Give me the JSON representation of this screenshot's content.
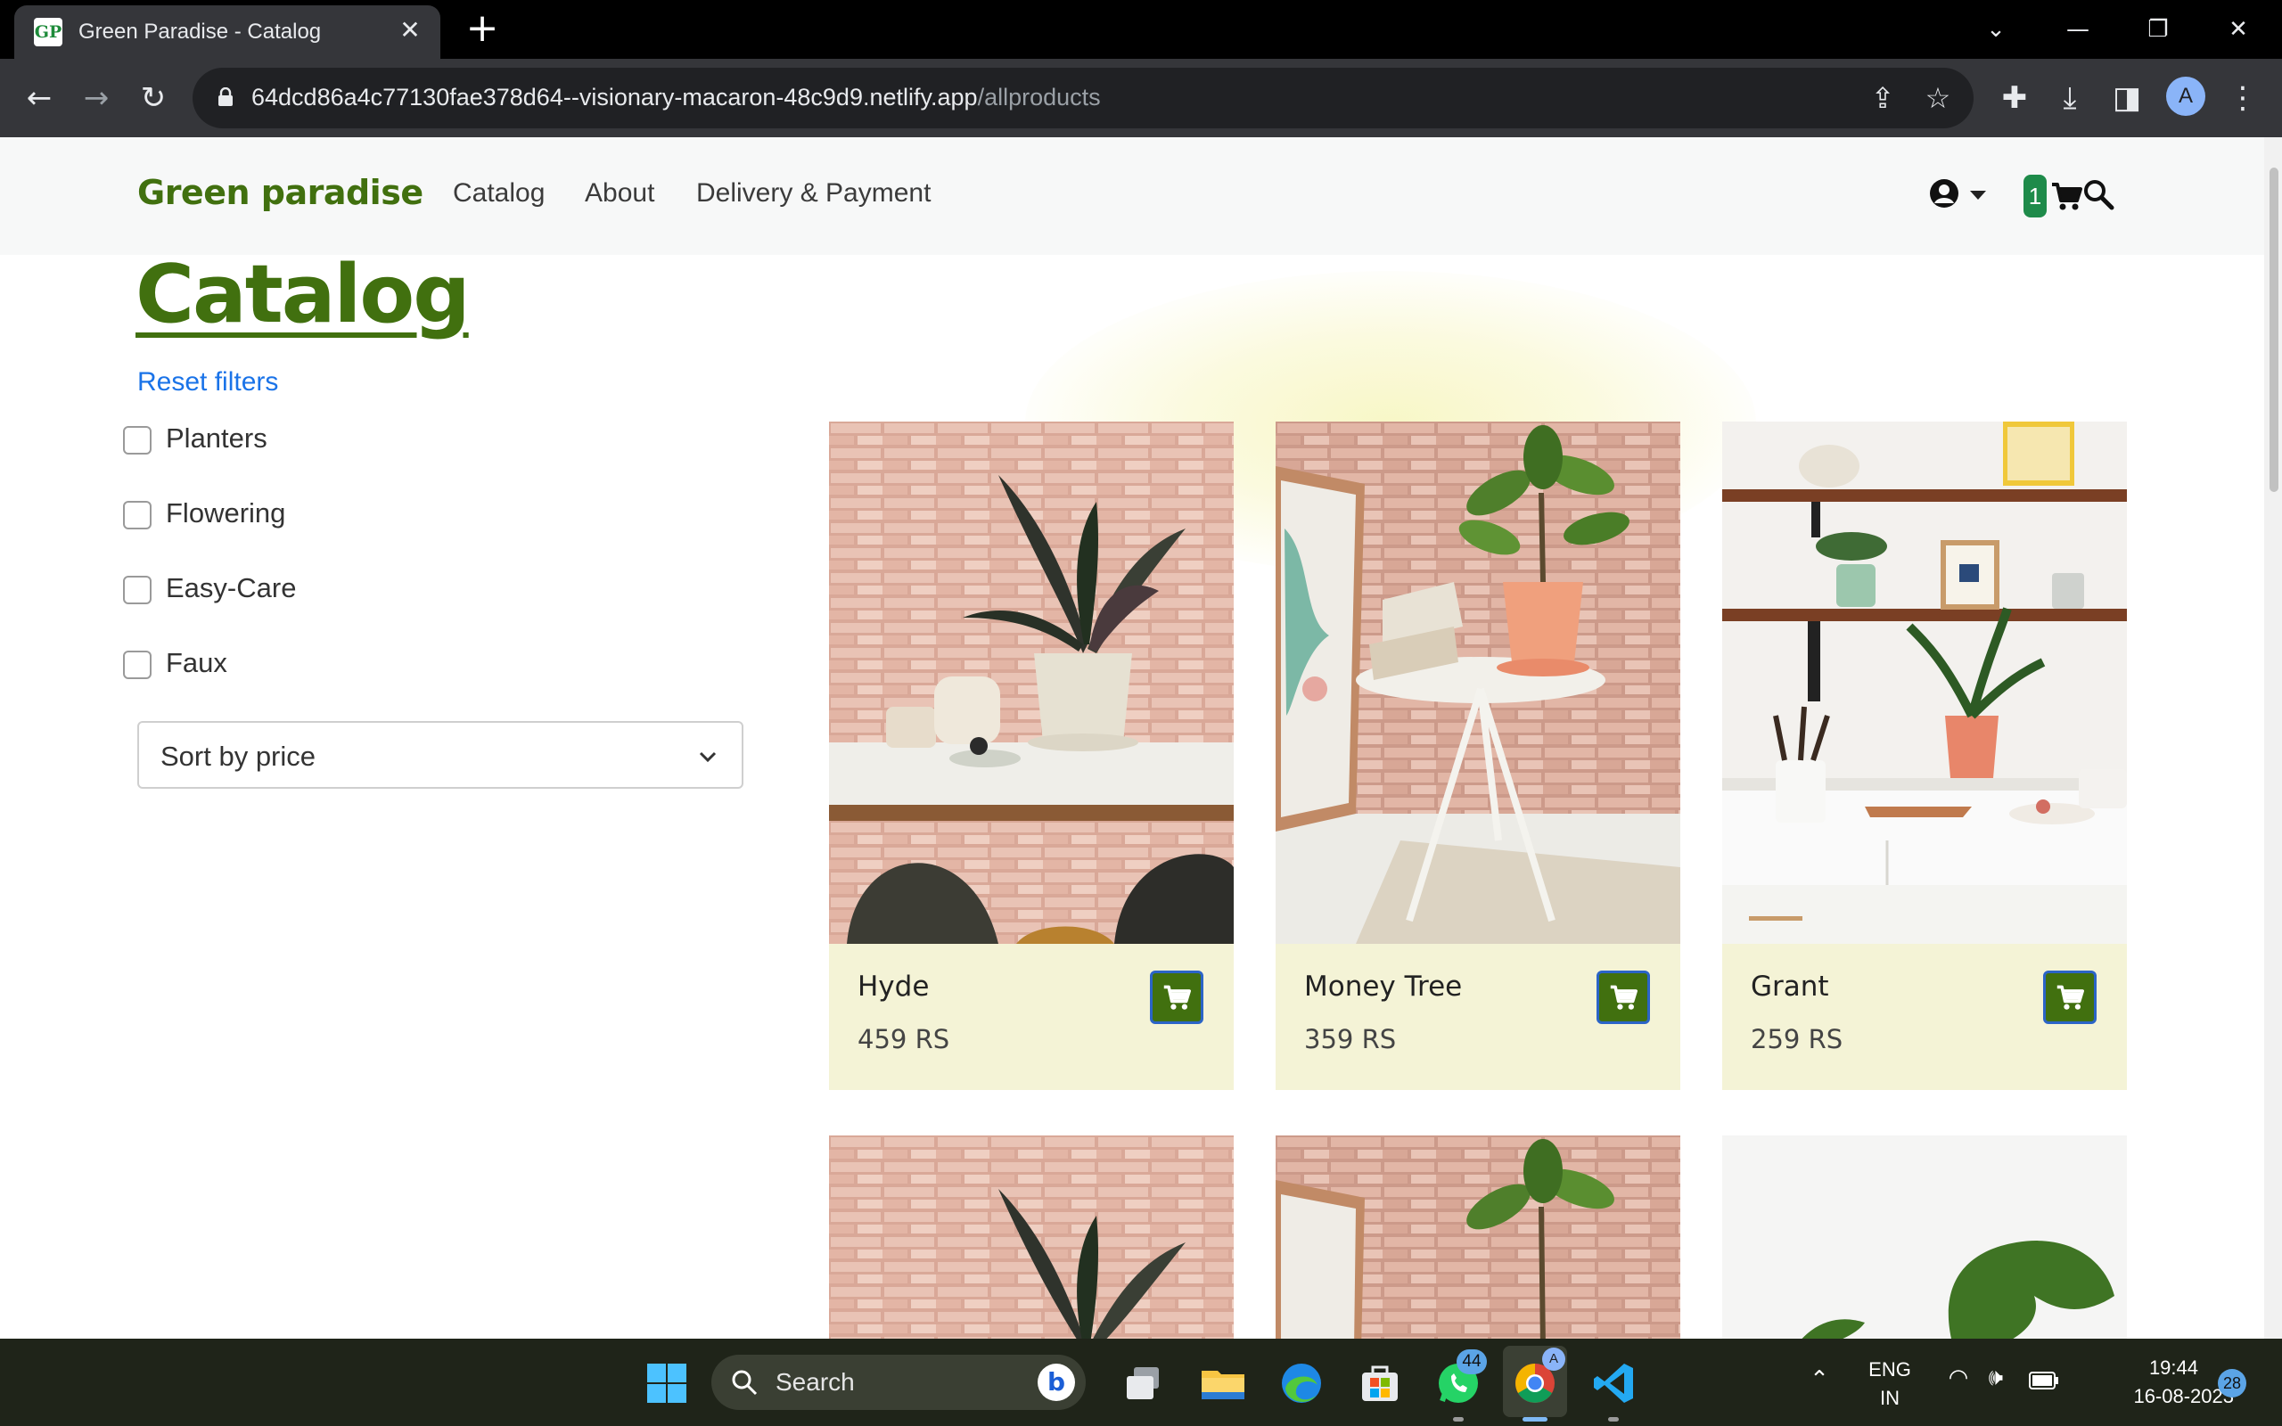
{
  "browser": {
    "tab_title": "Green Paradise - Catalog",
    "tab_favicon_text": "GP",
    "url_host": "64dcd86a4c77130fae378d64--visionary-macaron-48c9d9.netlify.app",
    "url_path": "/allproducts",
    "profile_initial": "A"
  },
  "site": {
    "brand": "Green paradise",
    "nav": [
      "Catalog",
      "About",
      "Delivery & Payment"
    ],
    "cart_count": "1"
  },
  "catalog": {
    "title": "Catalog",
    "reset_label": "Reset filters",
    "filters": [
      "Planters",
      "Flowering",
      "Easy-Care",
      "Faux"
    ],
    "sort_label": "Sort by price",
    "products": [
      {
        "name": "Hyde",
        "price": "459 RS"
      },
      {
        "name": "Money Tree",
        "price": "359 RS"
      },
      {
        "name": "Grant",
        "price": "259 RS"
      }
    ]
  },
  "taskbar": {
    "search_label": "Search",
    "whatsapp_badge": "44",
    "lang_line1": "ENG",
    "lang_line2": "IN",
    "time": "19:44",
    "date": "16-08-2023",
    "notification_count": "28"
  },
  "colors": {
    "brand_green": "#41700f",
    "card_bg": "#f4f3d6",
    "link_blue": "#1a73e8",
    "badge_green": "#1e8b4a"
  }
}
